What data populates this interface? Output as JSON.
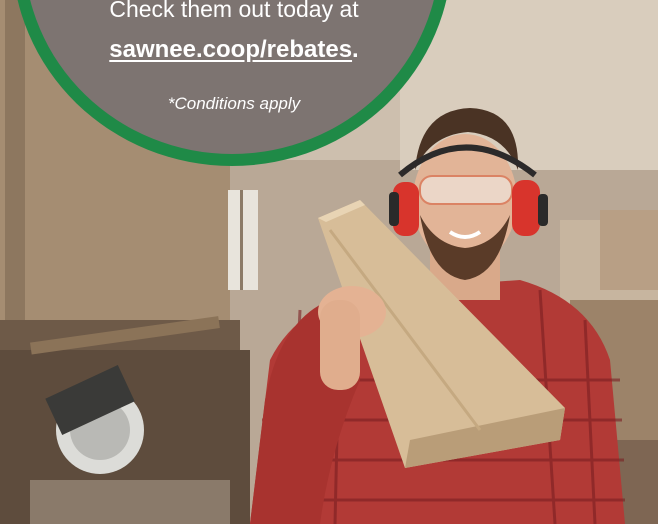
{
  "promo": {
    "line1": "Check them out today at",
    "link": "sawnee.coop/rebates",
    "link_suffix": ".",
    "conditions": "*Conditions apply"
  },
  "colors": {
    "badge_ring": "#1f8a47",
    "badge_fill": "#7d7471",
    "text": "#ffffff"
  }
}
